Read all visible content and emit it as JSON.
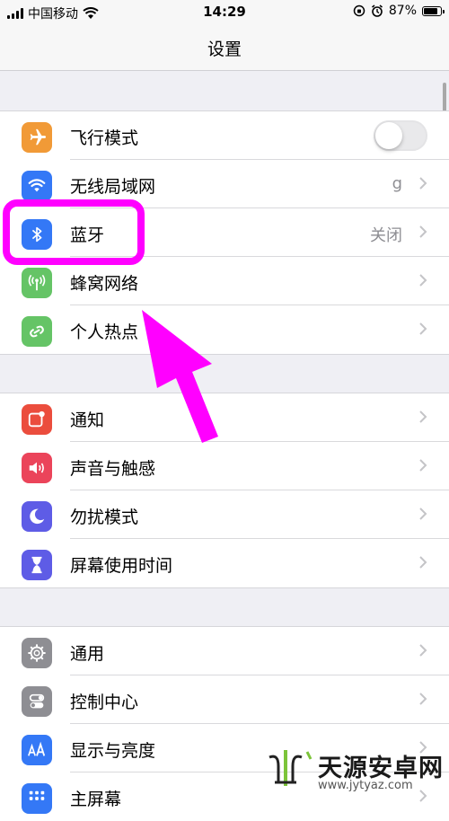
{
  "status_bar": {
    "carrier": "中国移动",
    "time": "14:29",
    "battery_percent": "87%",
    "battery_level": 0.87
  },
  "nav": {
    "title": "设置"
  },
  "groups": [
    {
      "rows": [
        {
          "label": "飞行模式",
          "icon": "airplane-icon",
          "color": "#f19a37",
          "control": "toggle",
          "toggle_on": false
        },
        {
          "label": "无线局域网",
          "icon": "wifi-icon",
          "color": "#3478f6",
          "value": "g"
        },
        {
          "label": "蓝牙",
          "icon": "bluetooth-icon",
          "color": "#3478f6",
          "value": "关闭"
        },
        {
          "label": "蜂窝网络",
          "icon": "antenna-icon",
          "color": "#65c466"
        },
        {
          "label": "个人热点",
          "icon": "link-icon",
          "color": "#65c466"
        }
      ]
    },
    {
      "rows": [
        {
          "label": "通知",
          "icon": "notification-icon",
          "color": "#eb4d3d"
        },
        {
          "label": "声音与触感",
          "icon": "speaker-icon",
          "color": "#eb445a"
        },
        {
          "label": "勿扰模式",
          "icon": "moon-icon",
          "color": "#5e5ce6"
        },
        {
          "label": "屏幕使用时间",
          "icon": "hourglass-icon",
          "color": "#5e5ce6"
        }
      ]
    },
    {
      "rows": [
        {
          "label": "通用",
          "icon": "gear-icon",
          "color": "#8e8e93"
        },
        {
          "label": "控制中心",
          "icon": "switches-icon",
          "color": "#8e8e93"
        },
        {
          "label": "显示与亮度",
          "icon": "text-size-icon",
          "color": "#3478f6"
        },
        {
          "label": "主屏幕",
          "icon": "home-grid-icon",
          "color": "#3478f6"
        }
      ]
    }
  ],
  "annotation": {
    "color": "#ff00ff"
  },
  "watermark": {
    "title": "天源安卓网",
    "url": "www.jytyaz.com"
  }
}
